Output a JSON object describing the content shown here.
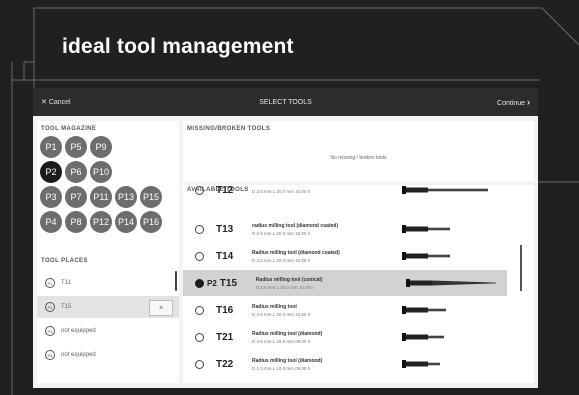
{
  "title": "ideal tool management",
  "topbar": {
    "cancel": "Cancel",
    "center": "SELECT TOOLS",
    "continue": "Continue"
  },
  "left": {
    "magazine_title": "TOOL MAGAZINE",
    "magazine": [
      [
        "P1",
        "P5",
        "P9"
      ],
      [
        "P2",
        "P6",
        "P10"
      ],
      [
        "P3",
        "P7",
        "P11",
        "P13",
        "P15"
      ],
      [
        "P4",
        "P8",
        "P12",
        "P14",
        "P16"
      ]
    ],
    "active_position": "P2",
    "places_title": "TOOL PLACES",
    "places": [
      {
        "badge": "P1",
        "text": "T11"
      },
      {
        "badge": "P2",
        "text": "T15",
        "selected": true
      },
      {
        "badge": "P3",
        "text": "not equipped"
      },
      {
        "badge": "P4",
        "text": "not equipped"
      }
    ],
    "remove_label": "×"
  },
  "right": {
    "missing_title": "MISSING/BROKEN TOOLS",
    "missing_message": "No missing / broken tools",
    "available_title": "AVAILABLE TOOLS",
    "tools": [
      {
        "code": "T12",
        "name": "",
        "dims": "D 2.5 mm L 20.0 mm 10.00 h"
      },
      {
        "code": "T13",
        "name": "radius milling tool (diamond coated)",
        "dims": "D 2.5 mm L 20.0 mm 10.00 h"
      },
      {
        "code": "T14",
        "name": "Radius milling tool (diamond coated)",
        "dims": "D 2.5 mm L 20.0 mm 10.00 h"
      },
      {
        "code": "T15",
        "name": "Radius milling tool (conical)",
        "dims": "D 2.5 mm L 20.0 mm 10.00 h",
        "selected": true,
        "place": "P2"
      },
      {
        "code": "T16",
        "name": "Radius milling tool",
        "dims": "D 2.5 mm L 20.0 mm 10.00 h"
      },
      {
        "code": "T21",
        "name": "Radius milling tool (diamond)",
        "dims": "D 2.5 mm L 15.5 mm 08.00 h"
      },
      {
        "code": "T22",
        "name": "Radius milling tool (diamond)",
        "dims": "D 1.0 mm L 10.0 mm 08.00 h"
      }
    ]
  }
}
